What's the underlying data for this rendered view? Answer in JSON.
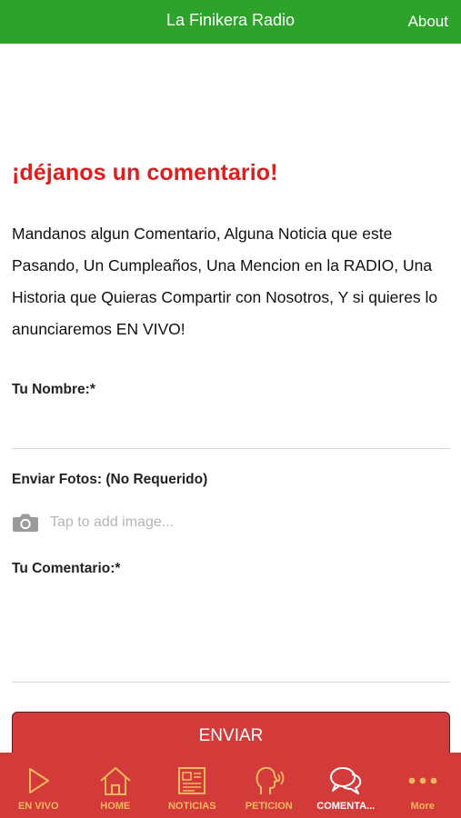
{
  "header": {
    "title": "La Finikera Radio",
    "about_label": "About"
  },
  "form": {
    "heading": "¡déjanos un comentario!",
    "intro": "Mandanos algun Comentario, Alguna Noticia que este Pasando, Un Cumpleaños, Una Mencion en la RADIO, Una Historia que Quieras Compartir con Nosotros, Y si quieres lo anunciaremos EN VIVO!",
    "name_label": "Tu Nombre:*",
    "name_value": "",
    "photos_label": "Enviar Fotos: (No Requerido)",
    "photos_hint": "Tap to add image...",
    "comment_label": "Tu Comentario:*",
    "comment_value": "",
    "submit_label": "ENVIAR"
  },
  "tabs": [
    {
      "label": "EN VIVO",
      "icon": "play-icon",
      "active": false
    },
    {
      "label": "HOME",
      "icon": "home-icon",
      "active": false
    },
    {
      "label": "NOTICIAS",
      "icon": "newspaper-icon",
      "active": false
    },
    {
      "label": "PETICION",
      "icon": "speaking-head-icon",
      "active": false
    },
    {
      "label": "COMENTA...",
      "icon": "chat-bubbles-icon",
      "active": true
    },
    {
      "label": "More",
      "icon": "more-dots-icon",
      "active": false
    }
  ],
  "colors": {
    "header_bg": "#2ea32b",
    "accent_red": "#e21b1b",
    "tabbar_bg": "#d33a3a",
    "tab_inactive": "#f1b85e",
    "tab_active": "#ffffff"
  }
}
